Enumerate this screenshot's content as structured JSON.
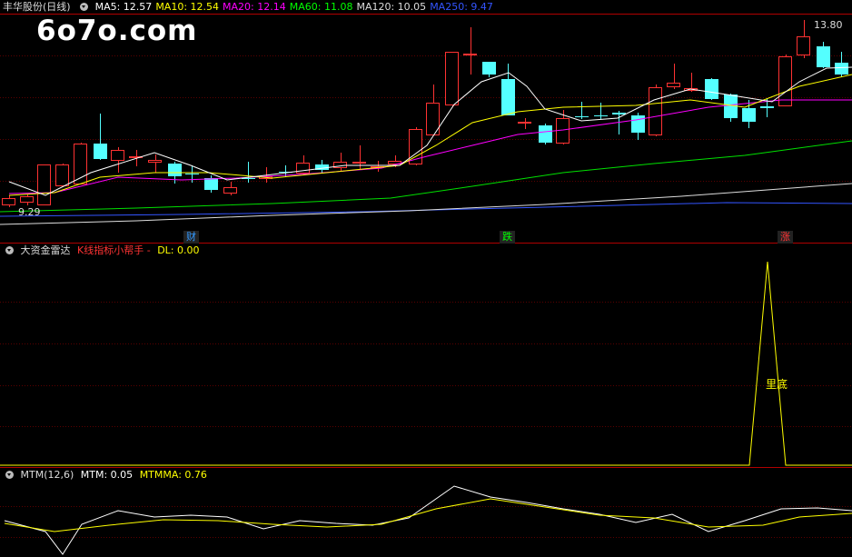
{
  "main": {
    "title": "丰华股份(日线)",
    "ma_labels": [
      {
        "text": "MA5: 12.57",
        "color": "#ffffff"
      },
      {
        "text": "MA10: 12.54",
        "color": "#ffff00"
      },
      {
        "text": "MA20: 12.14",
        "color": "#ff00ff"
      },
      {
        "text": "MA60: 11.08",
        "color": "#00ff00"
      },
      {
        "text": "MA120: 10.05",
        "color": "#dddddd"
      },
      {
        "text": "MA250: 9.47",
        "color": "#3355ff"
      }
    ],
    "watermark": "6o7o.com",
    "high_label": "13.80",
    "low_label": "9.29",
    "events": [
      {
        "text": "财",
        "color": "#3399ff"
      },
      {
        "text": "跌",
        "color": "#00ff00"
      },
      {
        "text": "涨",
        "color": "#ff3333"
      }
    ],
    "colors": {
      "up": "#ff3232",
      "down": "#54ffff",
      "grid": "#b00000"
    }
  },
  "indicator": {
    "title": "大资金雷达",
    "subtitle": "K线指标小帮手 -",
    "dl_label": "DL: 0.00",
    "peak_label": "里底"
  },
  "mtm": {
    "title": "MTM(12,6)",
    "mtm_label": "MTM: 0.05",
    "mtmma_label": "MTMMA: 0.76"
  }
}
